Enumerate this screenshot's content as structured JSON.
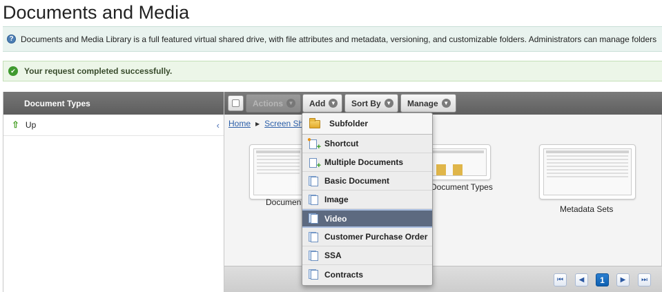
{
  "page": {
    "title": "Documents and Media",
    "info_text": "Documents and Media Library is a full featured virtual shared drive, with file attributes and metadata, versioning, and customizable folders. Administrators can manage folders",
    "success_text": "Your request completed successfully."
  },
  "sidebar": {
    "header": "Document Types",
    "up_label": "Up"
  },
  "toolbar": {
    "actions_label": "Actions",
    "add_label": "Add",
    "sort_label": "Sort By",
    "manage_label": "Manage"
  },
  "breadcrumb": {
    "home": "Home",
    "current": "Screen Sh"
  },
  "thumbnails": [
    {
      "label": "Documen"
    },
    {
      "label": "Document Types"
    },
    {
      "label": "Metadata Sets"
    }
  ],
  "add_menu": {
    "items": [
      {
        "label": "Subfolder",
        "icon": "folder-icon"
      },
      {
        "label": "Shortcut",
        "icon": "shortcut-icon"
      },
      {
        "label": "Multiple Documents",
        "icon": "add-documents-icon"
      },
      {
        "label": "Basic Document",
        "icon": "document-icon"
      },
      {
        "label": "Image",
        "icon": "document-icon"
      },
      {
        "label": "Video",
        "icon": "document-icon",
        "active": true
      },
      {
        "label": "Customer Purchase Order",
        "icon": "document-icon"
      },
      {
        "label": "SSA",
        "icon": "document-icon"
      },
      {
        "label": "Contracts",
        "icon": "document-icon"
      }
    ]
  },
  "pagination": {
    "current_page": "1"
  },
  "colors": {
    "toolbar": "#686868",
    "active_menu_item": "#5d6a80",
    "link": "#2b5ea8",
    "success": "#3f9a2f"
  }
}
